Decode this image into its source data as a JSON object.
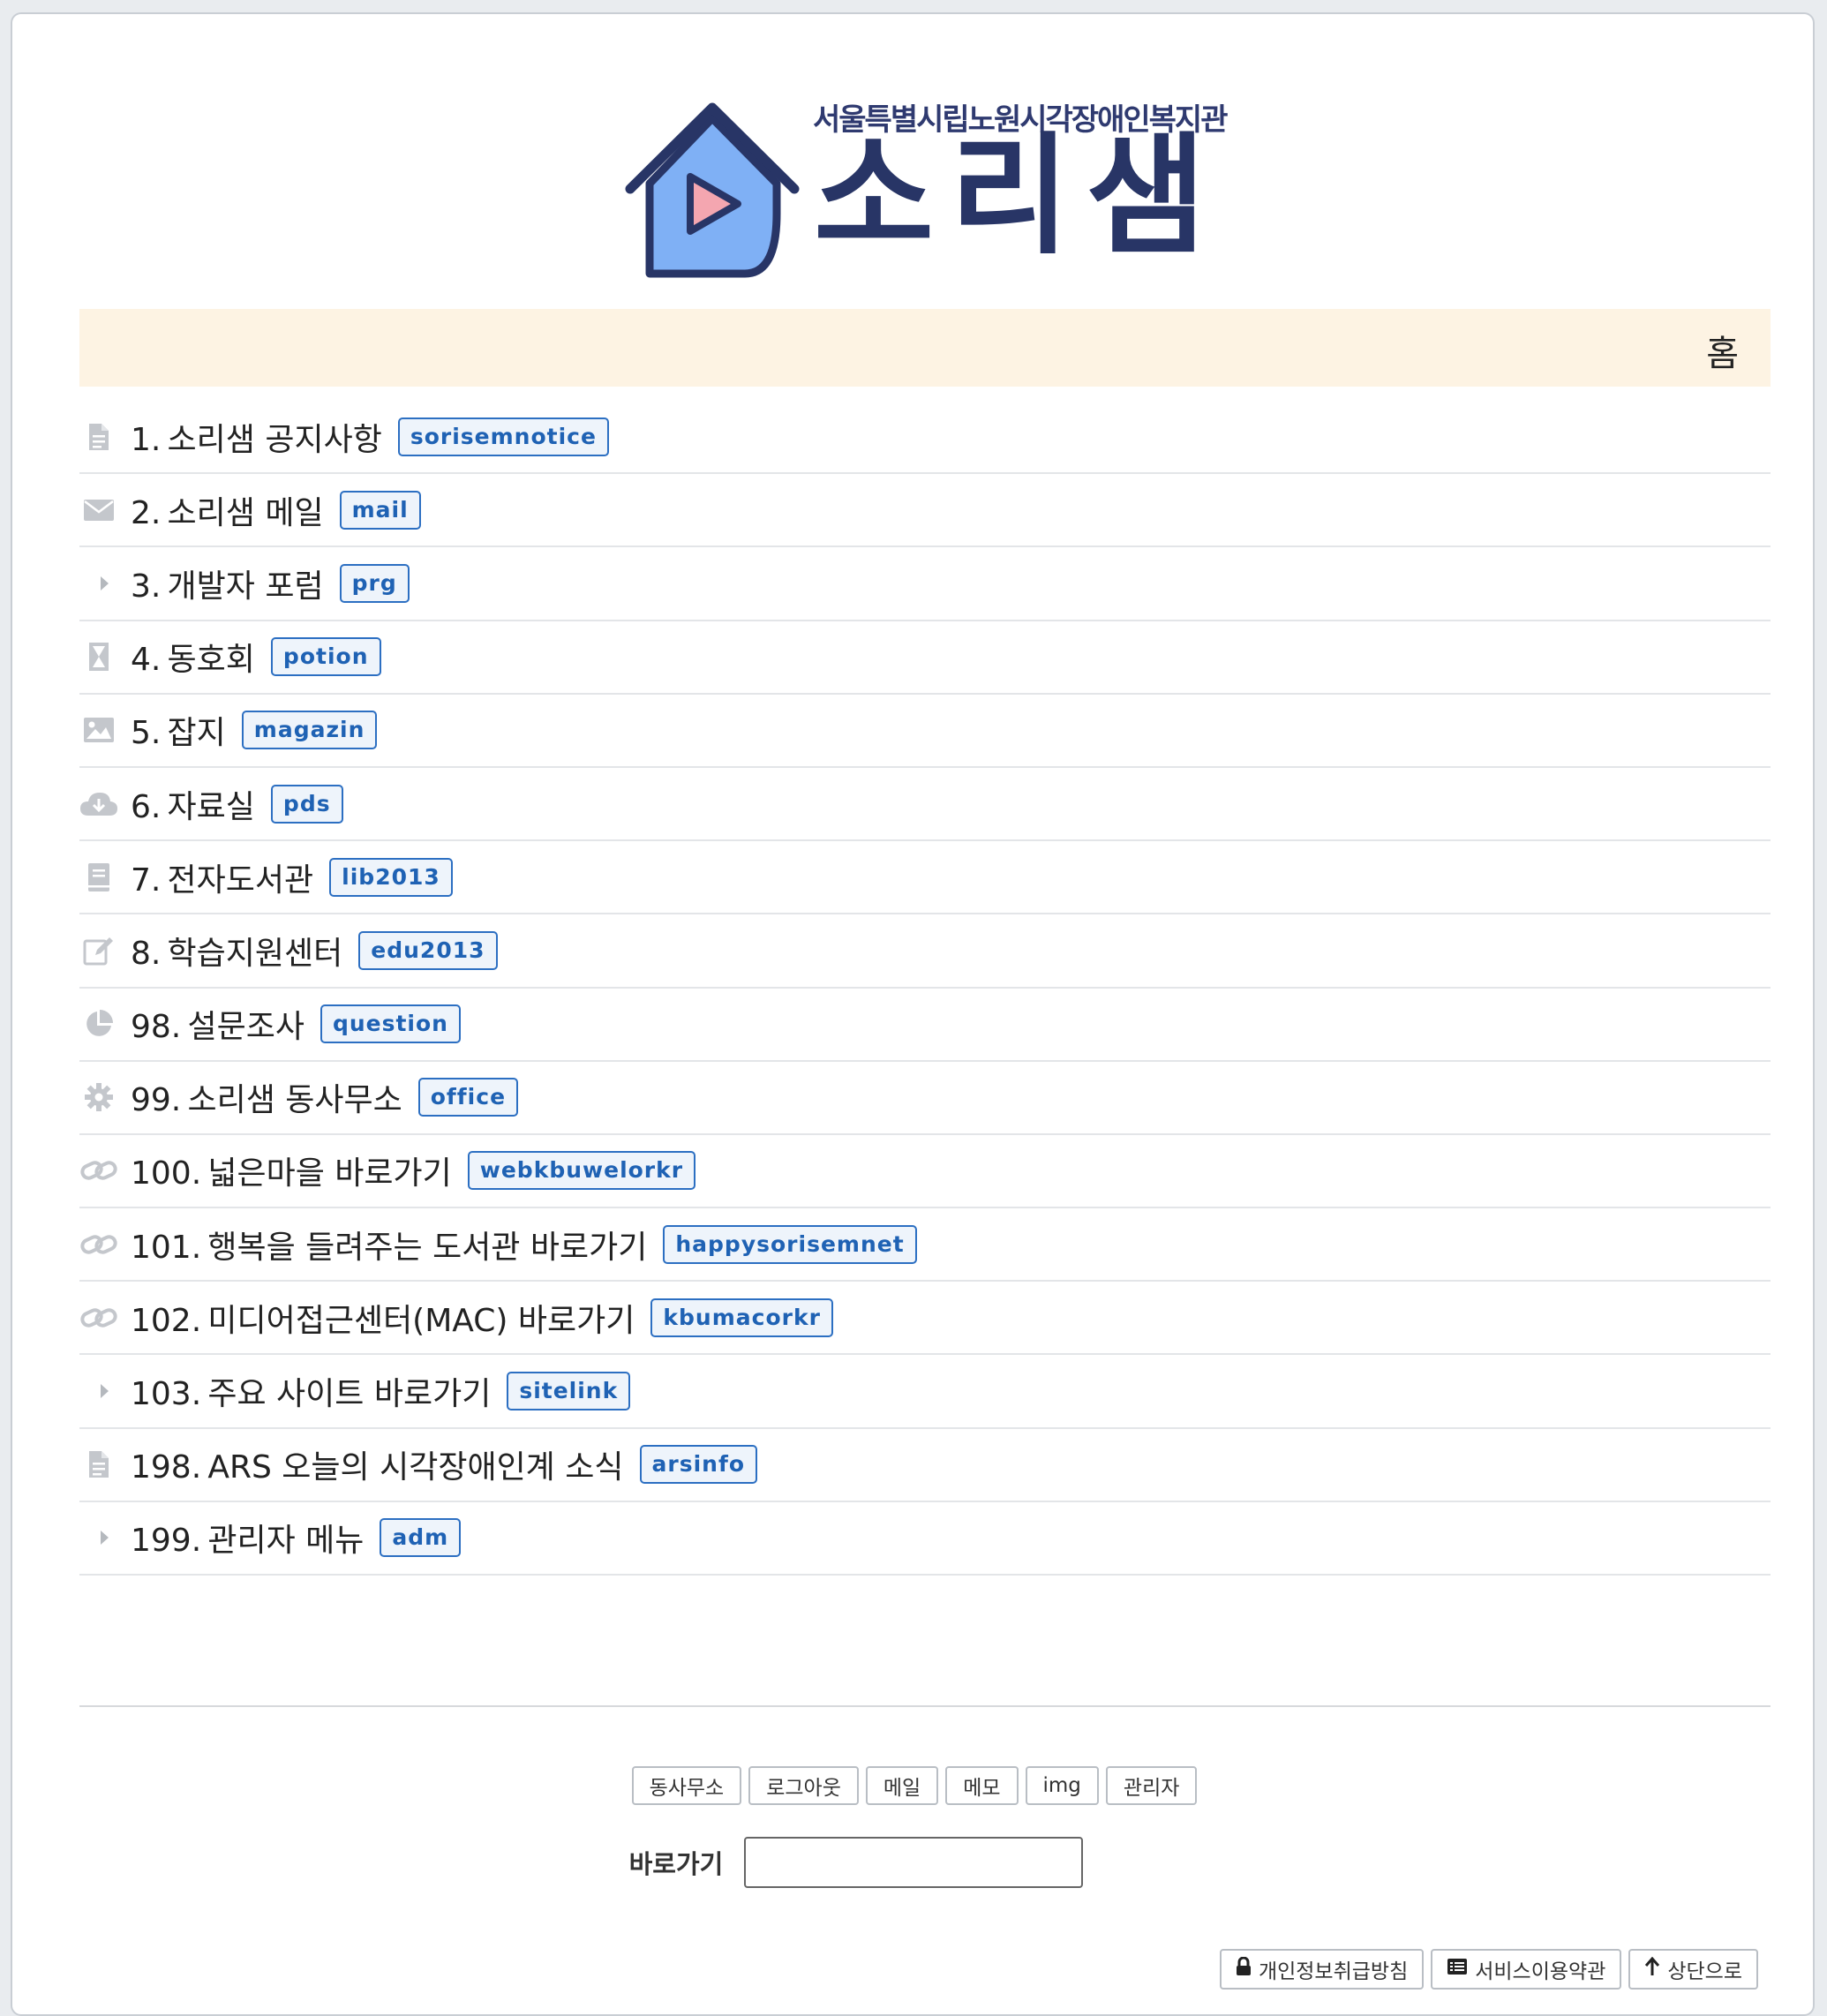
{
  "logo": {
    "subtitle": "서울특별시립노원시각장애인복지관",
    "title": "소리샘"
  },
  "breadcrumb": {
    "home": "홈"
  },
  "menu": [
    {
      "num": "1.",
      "title": "소리샘 공지사항",
      "id": "sorisemnotice",
      "icon": "document-icon"
    },
    {
      "num": "2.",
      "title": "소리샘 메일",
      "id": "mail",
      "icon": "envelope-icon"
    },
    {
      "num": "3.",
      "title": "개발자 포럼",
      "id": "prg",
      "icon": "caret-right-icon"
    },
    {
      "num": "4.",
      "title": "동호회",
      "id": "potion",
      "icon": "hourglass-icon"
    },
    {
      "num": "5.",
      "title": "잡지",
      "id": "magazin",
      "icon": "image-icon"
    },
    {
      "num": "6.",
      "title": "자료실",
      "id": "pds",
      "icon": "cloud-download-icon"
    },
    {
      "num": "7.",
      "title": "전자도서관",
      "id": "lib2013",
      "icon": "book-icon"
    },
    {
      "num": "8.",
      "title": "학습지원센터",
      "id": "edu2013",
      "icon": "edit-icon"
    },
    {
      "num": "98.",
      "title": "설문조사",
      "id": "question",
      "icon": "pie-chart-icon"
    },
    {
      "num": "99.",
      "title": "소리샘 동사무소",
      "id": "office",
      "icon": "gear-icon"
    },
    {
      "num": "100.",
      "title": "넓은마을 바로가기",
      "id": "webkbuwelorkr",
      "icon": "link-icon"
    },
    {
      "num": "101.",
      "title": "행복을 들려주는 도서관 바로가기",
      "id": "happysorisemnet",
      "icon": "link-icon"
    },
    {
      "num": "102.",
      "title": "미디어접근센터(MAC) 바로가기",
      "id": "kbumacorkr",
      "icon": "link-icon"
    },
    {
      "num": "103.",
      "title": "주요 사이트 바로가기",
      "id": "sitelink",
      "icon": "caret-right-icon"
    },
    {
      "num": "198.",
      "title": "ARS 오늘의 시각장애인계 소식",
      "id": "arsinfo",
      "icon": "document-icon"
    },
    {
      "num": "199.",
      "title": "관리자 메뉴",
      "id": "adm",
      "icon": "caret-right-icon"
    }
  ],
  "footer": {
    "buttons": [
      "동사무소",
      "로그아웃",
      "메일",
      "메모",
      "img",
      "관리자"
    ],
    "shortcut_label": "바로가기",
    "shortcut_value": "",
    "links": [
      {
        "label": "개인정보취급방침",
        "icon": "lock-icon"
      },
      {
        "label": "서비스이용약관",
        "icon": "list-icon"
      },
      {
        "label": "상단으로",
        "icon": "arrow-up-icon"
      }
    ]
  },
  "colors": {
    "home_bar": "#fdf3e3",
    "badge_text": "#1f62b4",
    "badge_border": "#2c6fc2",
    "logo_navy": "#283566",
    "logo_house": "#7fb0f5",
    "logo_play": "#f4a6b0",
    "icon_gray": "#c4c7cc"
  }
}
